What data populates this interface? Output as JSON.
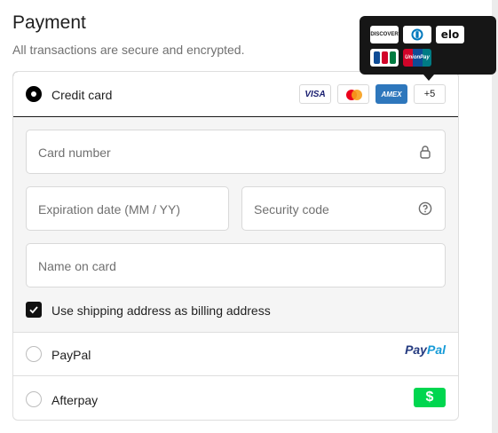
{
  "header": {
    "title": "Payment",
    "subtitle": "All transactions are secure and encrypted."
  },
  "credit_card": {
    "label": "Credit card",
    "selected": true,
    "brands": {
      "visa": "VISA",
      "mastercard_icon": "mastercard-logo",
      "amex": "AMEX",
      "more": "+5"
    },
    "fields": {
      "card_number": {
        "placeholder": "Card number",
        "value": ""
      },
      "expiration": {
        "placeholder": "Expiration date (MM / YY)",
        "value": ""
      },
      "security_code": {
        "placeholder": "Security code",
        "value": ""
      },
      "name_on_card": {
        "placeholder": "Name on card",
        "value": ""
      }
    },
    "billing_checkbox": {
      "label": "Use shipping address as billing address",
      "checked": true
    }
  },
  "tooltip": {
    "brands": {
      "discover": "DISCOVER",
      "diners_icon": "diners-club-logo",
      "elo": "elo",
      "jcb": "JCB",
      "unionpay": "UnionPay"
    }
  },
  "paypal": {
    "label": "PayPal",
    "logo_part1": "Pay",
    "logo_part2": "Pal",
    "selected": false
  },
  "afterpay": {
    "label": "Afterpay",
    "logo": "$",
    "selected": false
  },
  "colors": {
    "paypal_dark": "#253b80",
    "paypal_light": "#179bd7",
    "afterpay_green": "#00d64f",
    "amex_blue": "#2e77bc"
  }
}
